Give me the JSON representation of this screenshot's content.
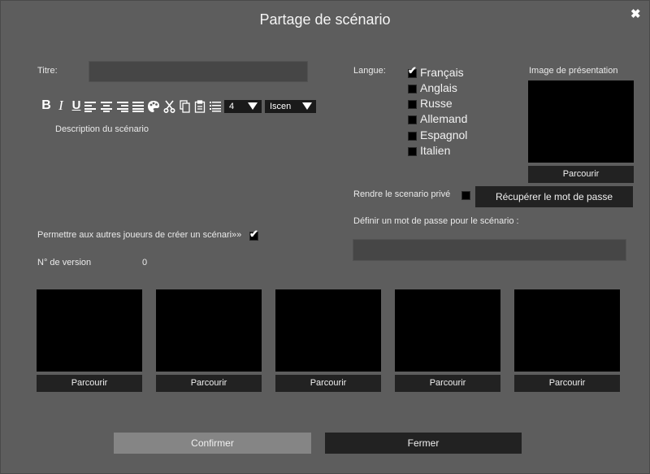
{
  "dialog": {
    "title": "Partage de scénario",
    "close_glyph": "✖"
  },
  "form": {
    "title_label": "Titre:",
    "title_value": "",
    "toolbar": {
      "bold_glyph": "B",
      "italic_glyph": "I",
      "underline_glyph": "U",
      "font_size_value": "4",
      "font_name_value": "Iscen",
      "icons": [
        "bold-icon",
        "italic-icon",
        "underline-icon",
        "align-left-icon",
        "align-center-icon",
        "align-right-icon",
        "align-justify-icon",
        "palette-icon",
        "cut-icon",
        "copy-icon",
        "paste-icon",
        "list-icon"
      ]
    },
    "description_placeholder": "Description du scénario",
    "allow_others_label": "Permettre aux autres joueurs de créer un scénari»»",
    "allow_others_checked": true,
    "version_label": "N° de version",
    "version_value": "0"
  },
  "language": {
    "label": "Langue:",
    "options": [
      {
        "label": "Français",
        "checked": true
      },
      {
        "label": "Anglais",
        "checked": false
      },
      {
        "label": "Russe",
        "checked": false
      },
      {
        "label": "Allemand",
        "checked": false
      },
      {
        "label": "Espagnol",
        "checked": false
      },
      {
        "label": "Italien",
        "checked": false
      }
    ]
  },
  "presentation_image": {
    "label": "Image de présentation",
    "browse_label": "Parcourir"
  },
  "privacy": {
    "private_label": "Rendre le scenario privé",
    "private_checked": false,
    "recover_password_label": "Récupérer le mot de passe",
    "password_label": "Définir un mot de passe pour le scénario :",
    "password_value": ""
  },
  "screenshots": [
    {
      "browse_label": "Parcourir"
    },
    {
      "browse_label": "Parcourir"
    },
    {
      "browse_label": "Parcourir"
    },
    {
      "browse_label": "Parcourir"
    },
    {
      "browse_label": "Parcourir"
    }
  ],
  "footer": {
    "confirm_label": "Confirmer",
    "close_label": "Fermer"
  },
  "colors": {
    "background": "#5d5d5d",
    "field": "#464646",
    "button_dark": "#222222",
    "button_confirm": "#858585"
  }
}
